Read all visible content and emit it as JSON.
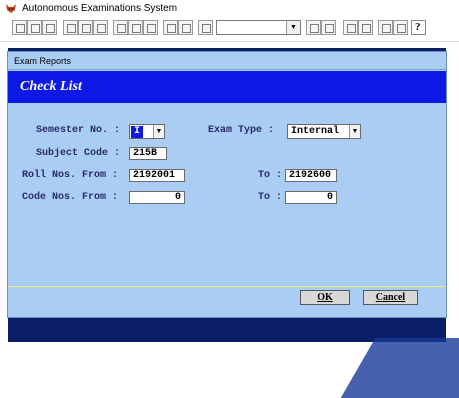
{
  "window": {
    "title": "Autonomous Examinations System"
  },
  "dialog": {
    "title": "Exam Reports",
    "banner": "Check List",
    "semester": {
      "label": "Semester No. :",
      "value": "I"
    },
    "exam_type": {
      "label": "Exam Type :",
      "value": "Internal"
    },
    "subject_code": {
      "label": "Subject Code :",
      "value": "215B"
    },
    "roll_from": {
      "label": "Roll Nos. From :",
      "value": "2192001"
    },
    "roll_to": {
      "label": "To :",
      "value": "2192600"
    },
    "code_from": {
      "label": "Code Nos. From :",
      "value": "0"
    },
    "code_to": {
      "label": "To :",
      "value": "0"
    },
    "ok_label": "OK",
    "cancel_label": "Cancel"
  },
  "colors": {
    "dialog_bg": "#a9cdf3",
    "banner": "#0b18e6",
    "desktop": "#0b1f66"
  },
  "icons": [
    "app-fox-icon",
    "new-icon",
    "open-icon",
    "save-icon",
    "print-icon",
    "preview-icon",
    "spell-icon",
    "cut-icon",
    "copy-icon",
    "paste-icon",
    "undo-icon",
    "redo-icon",
    "run-icon",
    "chart-icon",
    "help-icon"
  ]
}
